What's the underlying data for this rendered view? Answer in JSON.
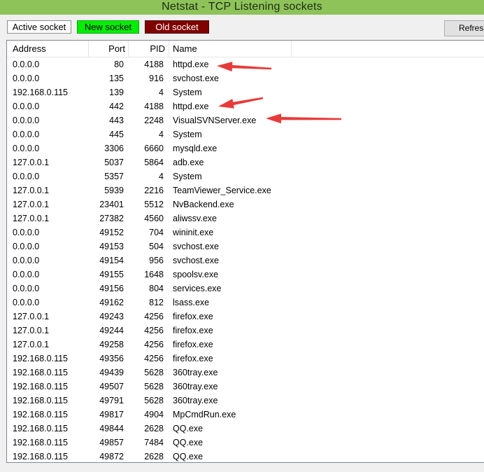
{
  "window": {
    "title": "Netstat - TCP Listening sockets"
  },
  "legend": {
    "active_label": "Active socket",
    "new_label": "New socket",
    "old_label": "Old socket",
    "new_color": "#00ee00",
    "old_color": "#800000"
  },
  "toolbar": {
    "refresh_label": "Refresh"
  },
  "table": {
    "columns": [
      "Address",
      "Port",
      "PID",
      "Name"
    ],
    "rows": [
      {
        "address": "0.0.0.0",
        "port": "80",
        "pid": "4188",
        "name": "httpd.exe"
      },
      {
        "address": "0.0.0.0",
        "port": "135",
        "pid": "916",
        "name": "svchost.exe"
      },
      {
        "address": "192.168.0.115",
        "port": "139",
        "pid": "4",
        "name": "System"
      },
      {
        "address": "0.0.0.0",
        "port": "442",
        "pid": "4188",
        "name": "httpd.exe"
      },
      {
        "address": "0.0.0.0",
        "port": "443",
        "pid": "2248",
        "name": "VisualSVNServer.exe"
      },
      {
        "address": "0.0.0.0",
        "port": "445",
        "pid": "4",
        "name": "System"
      },
      {
        "address": "0.0.0.0",
        "port": "3306",
        "pid": "6660",
        "name": "mysqld.exe"
      },
      {
        "address": "127.0.0.1",
        "port": "5037",
        "pid": "5864",
        "name": "adb.exe"
      },
      {
        "address": "0.0.0.0",
        "port": "5357",
        "pid": "4",
        "name": "System"
      },
      {
        "address": "127.0.0.1",
        "port": "5939",
        "pid": "2216",
        "name": "TeamViewer_Service.exe"
      },
      {
        "address": "127.0.0.1",
        "port": "23401",
        "pid": "5512",
        "name": "NvBackend.exe"
      },
      {
        "address": "127.0.0.1",
        "port": "27382",
        "pid": "4560",
        "name": "aliwssv.exe"
      },
      {
        "address": "0.0.0.0",
        "port": "49152",
        "pid": "704",
        "name": "wininit.exe"
      },
      {
        "address": "0.0.0.0",
        "port": "49153",
        "pid": "504",
        "name": "svchost.exe"
      },
      {
        "address": "0.0.0.0",
        "port": "49154",
        "pid": "956",
        "name": "svchost.exe"
      },
      {
        "address": "0.0.0.0",
        "port": "49155",
        "pid": "1648",
        "name": "spoolsv.exe"
      },
      {
        "address": "0.0.0.0",
        "port": "49156",
        "pid": "804",
        "name": "services.exe"
      },
      {
        "address": "0.0.0.0",
        "port": "49162",
        "pid": "812",
        "name": "lsass.exe"
      },
      {
        "address": "127.0.0.1",
        "port": "49243",
        "pid": "4256",
        "name": "firefox.exe"
      },
      {
        "address": "127.0.0.1",
        "port": "49244",
        "pid": "4256",
        "name": "firefox.exe"
      },
      {
        "address": "127.0.0.1",
        "port": "49258",
        "pid": "4256",
        "name": "firefox.exe"
      },
      {
        "address": "192.168.0.115",
        "port": "49356",
        "pid": "4256",
        "name": "firefox.exe"
      },
      {
        "address": "192.168.0.115",
        "port": "49439",
        "pid": "5628",
        "name": "360tray.exe"
      },
      {
        "address": "192.168.0.115",
        "port": "49507",
        "pid": "5628",
        "name": "360tray.exe"
      },
      {
        "address": "192.168.0.115",
        "port": "49791",
        "pid": "5628",
        "name": "360tray.exe"
      },
      {
        "address": "192.168.0.115",
        "port": "49817",
        "pid": "4904",
        "name": "MpCmdRun.exe"
      },
      {
        "address": "192.168.0.115",
        "port": "49844",
        "pid": "2628",
        "name": "QQ.exe"
      },
      {
        "address": "192.168.0.115",
        "port": "49857",
        "pid": "7484",
        "name": "QQ.exe"
      },
      {
        "address": "192.168.0.115",
        "port": "49872",
        "pid": "2628",
        "name": "QQ.exe"
      }
    ]
  },
  "annotations": {
    "arrow_color": "#e83a3a"
  }
}
